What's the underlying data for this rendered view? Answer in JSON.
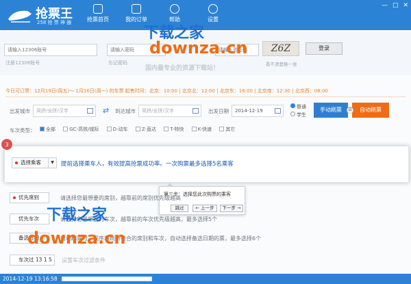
{
  "app": {
    "name": "抢票王",
    "slogan": "258 抢 票 神 器"
  },
  "nav": [
    {
      "label": "抢票首页"
    },
    {
      "label": "我的订单"
    },
    {
      "label": "帮助"
    },
    {
      "label": "设置"
    }
  ],
  "window_controls": [
    "—",
    "□",
    "✕"
  ],
  "login": {
    "account_placeholder": "请输入12306账号",
    "account_hint": "注册12306账号",
    "password_placeholder": "请输入密码",
    "password_hint": "忘记密码",
    "captcha_placeholder": "请输入验证码",
    "captcha_text": "Z6Z",
    "captcha_hint": "看不清楚换一张",
    "login_button": "登录"
  },
  "schedule": "今日可订票：12月19日(周五)～ 1月16日(周一) 的车票   起售时间：北京：10:00  |  北京北：12:00  |  北京东：16:00  |  北京南：12:30  |  北京西：08:00",
  "search": {
    "from_label": "出发城市",
    "from_placeholder": "简拼/全拼/汉字",
    "to_label": "到达城市",
    "to_placeholder": "简拼/全拼/汉字",
    "date_label": "出发日期",
    "date_value": "2014-12-19",
    "ticket_types": [
      "普通",
      "学生"
    ],
    "manual_button": "手动刷票",
    "or": "或",
    "auto_button": "自动刷票"
  },
  "train_types": {
    "label": "车次类型：",
    "options": [
      "全部",
      "GC-高铁/城际",
      "D-动车",
      "Z-直达",
      "T-特快",
      "K-快速",
      "其它"
    ]
  },
  "highlight": {
    "step": "3",
    "select_button": "选择乘客",
    "hint": "提前选择乘车人，有效提高抢票成功率。一次购票最多选择5名乘客"
  },
  "tooltip": {
    "title": "第三步：选择您此次购票的乘客",
    "skip": "跳过",
    "prev": "← 上一步",
    "next": "下一步 →"
  },
  "lower": [
    {
      "button": "优先席别",
      "text": "请选择您最想要的席别，越靠前的席别优先级越高"
    },
    {
      "button": "优先车次",
      "text": "请选择您最想要的车次，越靠前的车次优先级越高，最多选择5个"
    },
    {
      "button": "备选日期",
      "text": "自动刷票时，程序将刷新符合的席别和车次，自动选择备选日期的票，最多选择6个"
    },
    {
      "button": "车次过",
      "text": "13 1 5",
      "extra": "设置车次过滤条件"
    }
  ],
  "watermark": {
    "line1": "下载之家",
    "line2": "downza.cn",
    "tagline": "国内最专业的资源下载站！"
  },
  "status": {
    "datetime": "2014-12-19 13:16:58"
  },
  "colors": {
    "primary": "#2c83d6",
    "accent": "#ee6b17",
    "step": "#d9534f"
  }
}
